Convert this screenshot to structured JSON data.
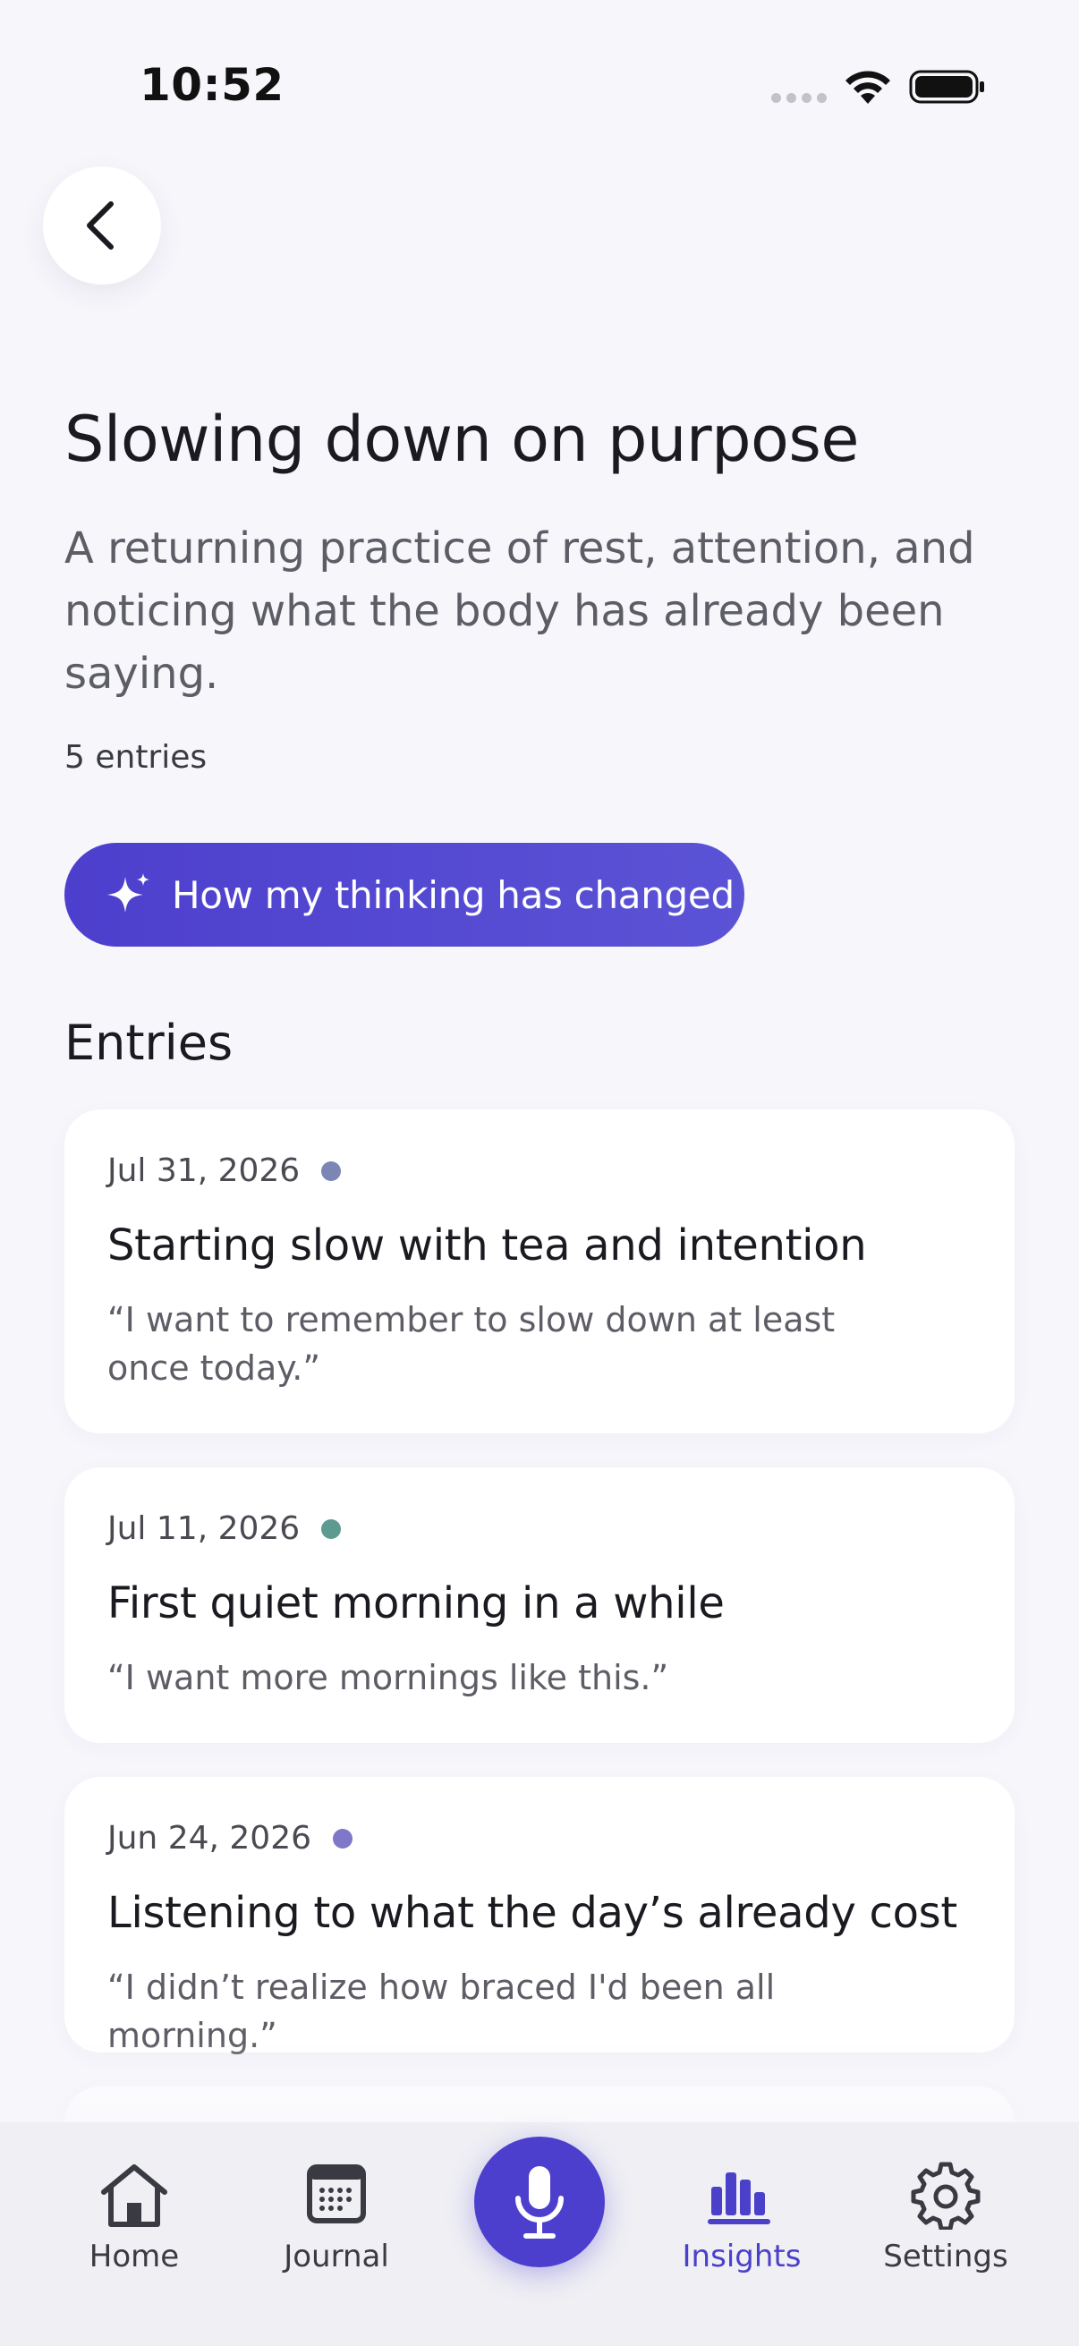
{
  "status_bar": {
    "time": "10:52"
  },
  "header": {
    "title": "Slowing down on purpose",
    "subtitle": "A returning practice of rest, attention, and noticing what the body has already been saying.",
    "entry_count": "5 entries"
  },
  "cta": {
    "label": "How my thinking has changed",
    "color": "#4d3fcd"
  },
  "entries_section": {
    "heading": "Entries",
    "items": [
      {
        "date": "Jul 31, 2026",
        "dot_color": "#7b86b4",
        "title": "Starting slow with tea and intention",
        "quote": "“I want to remember to slow down at least once today.”"
      },
      {
        "date": "Jul 11, 2026",
        "dot_color": "#5e9a90",
        "title": "First quiet morning in a while",
        "quote": "“I want more mornings like this.”"
      },
      {
        "date": "Jun 24, 2026",
        "dot_color": "#7f78c8",
        "title": "Listening to what the day’s already cost",
        "quote": "“I didn’t realize how braced I'd been all morning.”"
      }
    ]
  },
  "tab_bar": {
    "items": [
      {
        "label": "Home",
        "icon": "home-icon",
        "active": false
      },
      {
        "label": "Journal",
        "icon": "calendar-icon",
        "active": false
      },
      {
        "label": "Insights",
        "icon": "bar-chart-icon",
        "active": true
      },
      {
        "label": "Settings",
        "icon": "gear-icon",
        "active": false
      }
    ],
    "record_icon": "microphone-icon",
    "active_color": "#4b40c9"
  }
}
